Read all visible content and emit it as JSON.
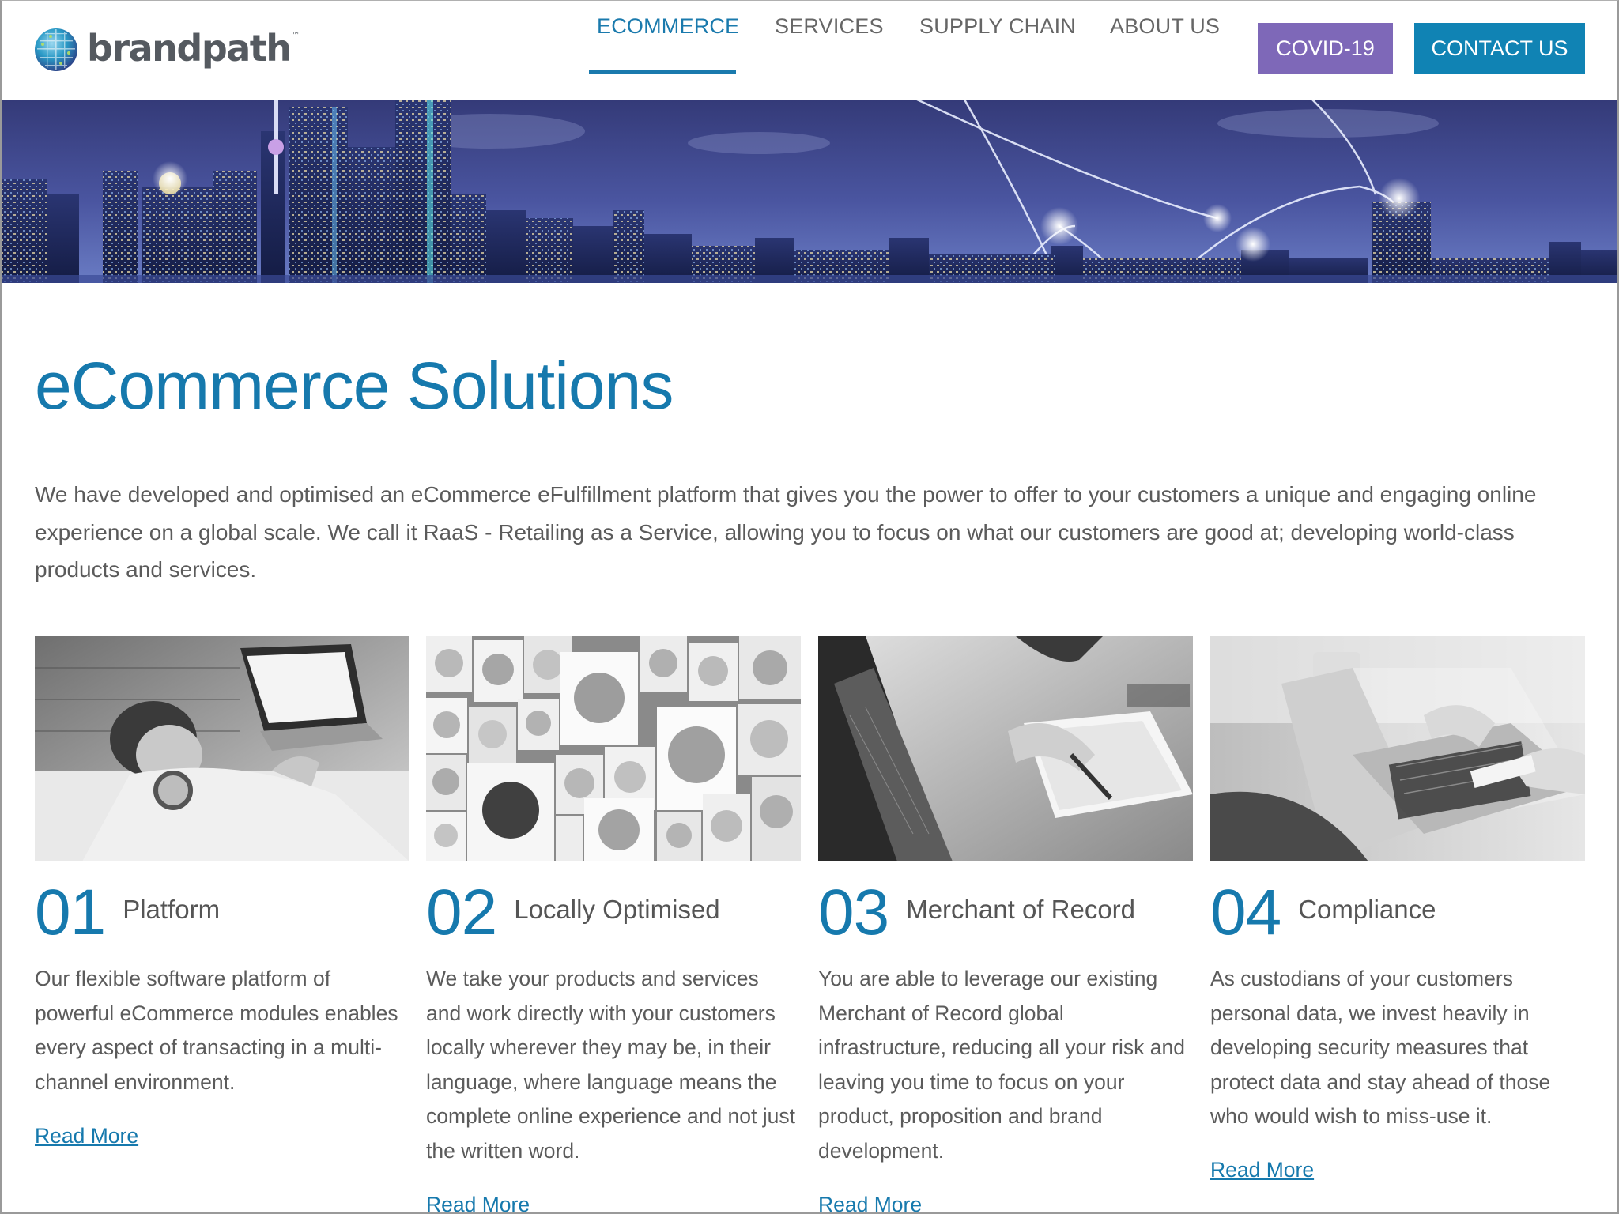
{
  "brand": {
    "name": "brandpath",
    "tm": "™"
  },
  "nav": {
    "items": [
      {
        "label": "ECOMMERCE",
        "active": true
      },
      {
        "label": "SERVICES",
        "active": false
      },
      {
        "label": "SUPPLY CHAIN",
        "active": false
      },
      {
        "label": "ABOUT US",
        "active": false
      }
    ],
    "covid_label": "COVID-19",
    "contact_label": "CONTACT US"
  },
  "page": {
    "title": "eCommerce Solutions",
    "intro": "We have developed and optimised an eCommerce eFulfillment platform that gives you the power to offer to your customers a unique and engaging online experience on a global scale. We call it RaaS - Retailing as a Service, allowing you to focus on what our customers are good at; developing world-class products and services."
  },
  "cards": [
    {
      "number": "01",
      "title": "Platform",
      "text": "Our flexible software platform of powerful eCommerce modules enables every aspect of transacting in a multi-channel environment.",
      "link": "Read More"
    },
    {
      "number": "02",
      "title": "Locally Optimised",
      "text": "We take your products and services and work directly with your customers locally wherever they may be, in their language, where language means the complete online experience and not just the written word.",
      "link": "Read More"
    },
    {
      "number": "03",
      "title": "Merchant of Record",
      "text": "You are able to leverage our existing Merchant of Record global infrastructure, reducing all your risk and leaving you time to focus on your product, proposition and brand development.",
      "link": "Read More"
    },
    {
      "number": "04",
      "title": "Compliance",
      "text": "As custodians of your customers personal data, we invest heavily in developing security measures that protect data and stay ahead of those who would wish to miss-use it.",
      "link": "Read More"
    }
  ],
  "colors": {
    "accent": "#1679ad",
    "covid": "#7e68b8",
    "contact": "#1083b4",
    "text": "#5b5b5b"
  }
}
